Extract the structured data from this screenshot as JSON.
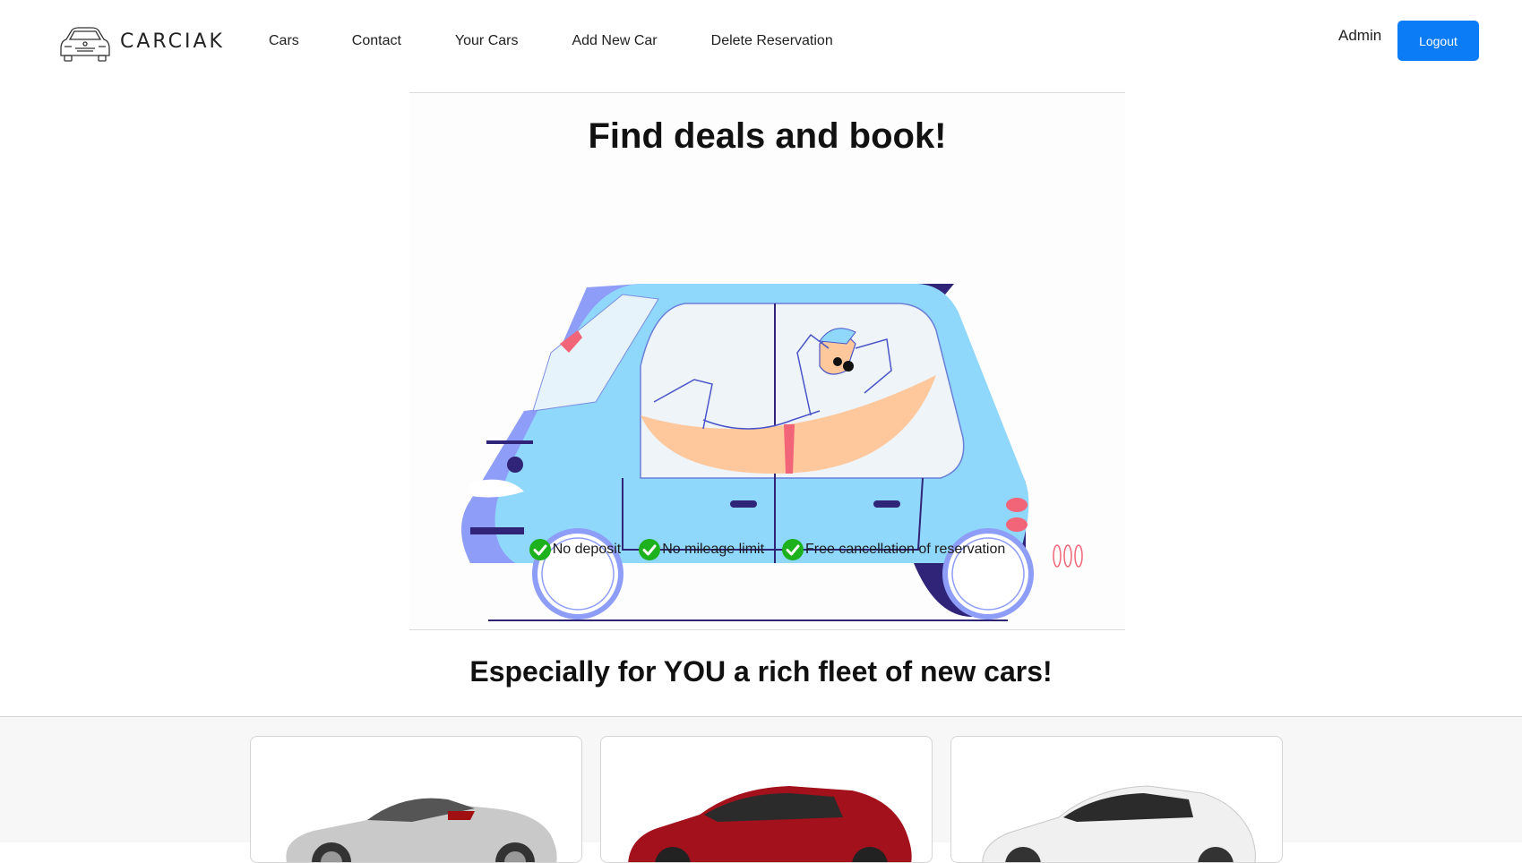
{
  "brand": {
    "name": "CARCIAK",
    "logo_icon": "car-outline-icon"
  },
  "nav": {
    "links": [
      "Cars",
      "Contact",
      "Your Cars",
      "Add New Car",
      "Delete Reservation"
    ],
    "user": "Admin",
    "logout_label": "Logout"
  },
  "colors": {
    "accent": "#0b7cf6",
    "check": "#1db11d"
  },
  "hero": {
    "title": "Find deals and book!",
    "illustration": "car-hammock-illustration",
    "features": [
      "No deposit",
      "No mileage limit",
      "Free cancellation of reservation"
    ]
  },
  "fleet": {
    "title": "Especially for YOU a rich fleet of new cars!",
    "cars": [
      {
        "image": "silver-convertible-car",
        "color": "#c9c9c9"
      },
      {
        "image": "red-sedan-car",
        "color": "#a3111c"
      },
      {
        "image": "white-coupe-car",
        "color": "#f0f0f0"
      }
    ]
  }
}
